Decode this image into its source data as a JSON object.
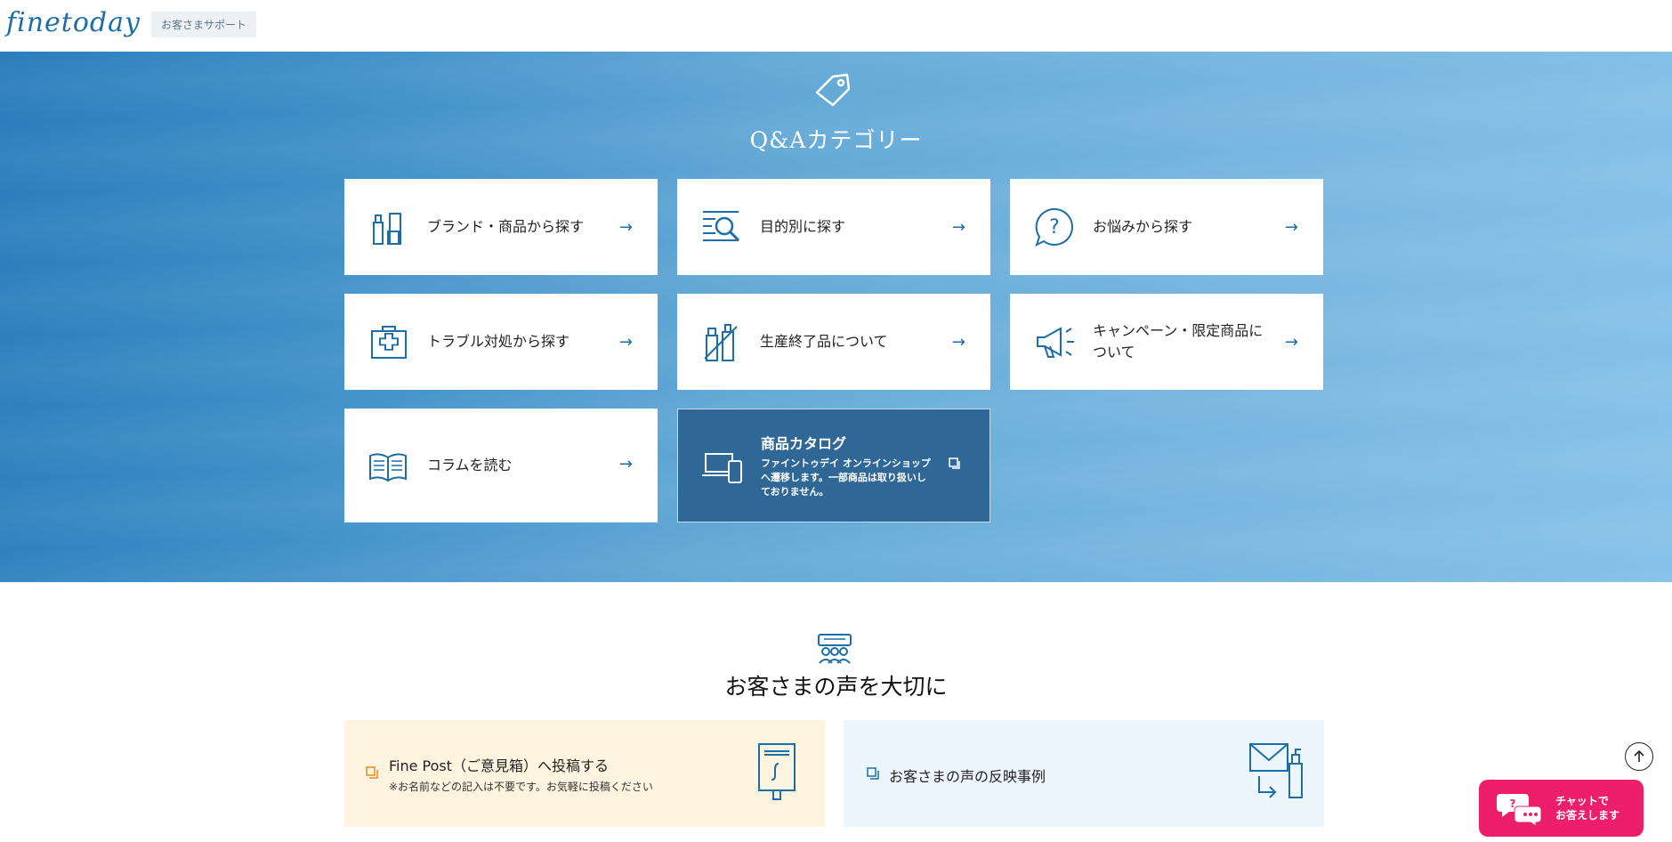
{
  "header": {
    "logo": "finetoday",
    "support_badge": "お客さまサポート"
  },
  "hero": {
    "title": "Q&Aカテゴリー",
    "icon": "tag-icon",
    "cards": [
      {
        "label": "ブランド・商品から探す",
        "icon": "products-icon",
        "arrow": "→"
      },
      {
        "label": "目的別に探す",
        "icon": "search-list-icon",
        "arrow": "→"
      },
      {
        "label": "お悩みから探す",
        "icon": "question-bubble-icon",
        "arrow": "→"
      },
      {
        "label": "トラブル対処から探す",
        "icon": "first-aid-kit-icon",
        "arrow": "→"
      },
      {
        "label": "生産終了品について",
        "icon": "discontinued-products-icon",
        "arrow": "→"
      },
      {
        "label": "キャンペーン・限定商品について",
        "icon": "megaphone-icon",
        "arrow": "→"
      },
      {
        "label": "コラムを読む",
        "icon": "open-book-icon",
        "arrow": "→"
      }
    ],
    "catalog": {
      "title": "商品カタログ",
      "description": "ファイントゥデイ オンラインショップへ遷移します。一部商品は取り扱いしておりません。",
      "icon": "devices-icon"
    }
  },
  "voice": {
    "title": "お客さまの声を大切に",
    "icon": "customers-icon",
    "post": {
      "title": "Fine Post（ご意見箱）へ投稿する",
      "note": "※お名前などの記入は不要です。お気軽に投稿ください",
      "icon": "mailbox-icon"
    },
    "reflect": {
      "title": "お客さまの声の反映事例",
      "icon": "mail-product-icon"
    }
  },
  "floating": {
    "back_to_top_icon": "arrow-up-icon",
    "chat_label": "チャットで\nお答えします",
    "chat_icon": "chat-bubbles-icon"
  },
  "colors": {
    "accent": "#1b6ea8",
    "catalog_bg": "#2f6896",
    "post_bg": "#fff4e0",
    "reflect_bg": "#eef6fd",
    "chat_bg": "#ee1f6a"
  }
}
